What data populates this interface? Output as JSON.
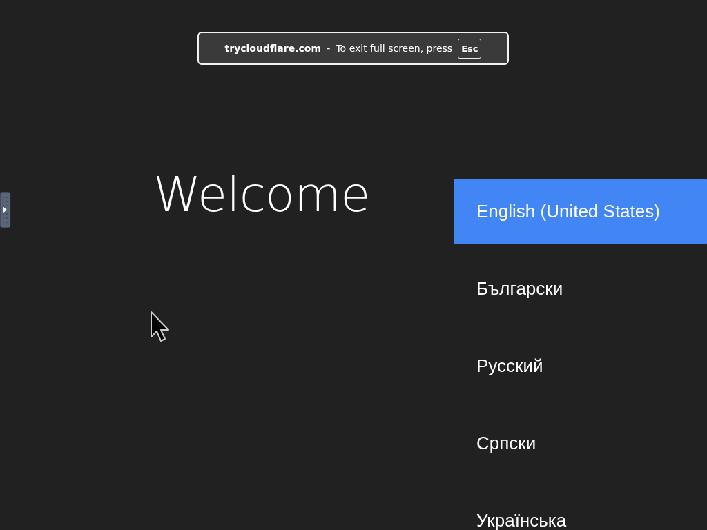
{
  "fullscreen_notice": {
    "site": "trycloudflare.com",
    "separator": "-",
    "message": "To exit full screen, press",
    "key": "Esc"
  },
  "heading": "Welcome",
  "languages": [
    {
      "label": "English (United States)",
      "selected": true
    },
    {
      "label": "Български",
      "selected": false
    },
    {
      "label": "Русский",
      "selected": false
    },
    {
      "label": "Српски",
      "selected": false
    },
    {
      "label": "Українська",
      "selected": false
    }
  ]
}
